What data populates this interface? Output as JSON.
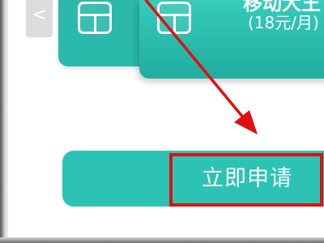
{
  "nav": {
    "back_glyph": "<",
    "back_icon": "chevron-left-icon"
  },
  "card": {
    "title_fragment": "移动大王",
    "price_text": "(18元/月)",
    "chip_icon": "sim-chip-icon"
  },
  "action": {
    "apply_label": "立即申请",
    "button_color": "#2cc3b5"
  },
  "annotation": {
    "highlight_color": "#e01010",
    "arrow_icon": "red-arrow-icon"
  }
}
